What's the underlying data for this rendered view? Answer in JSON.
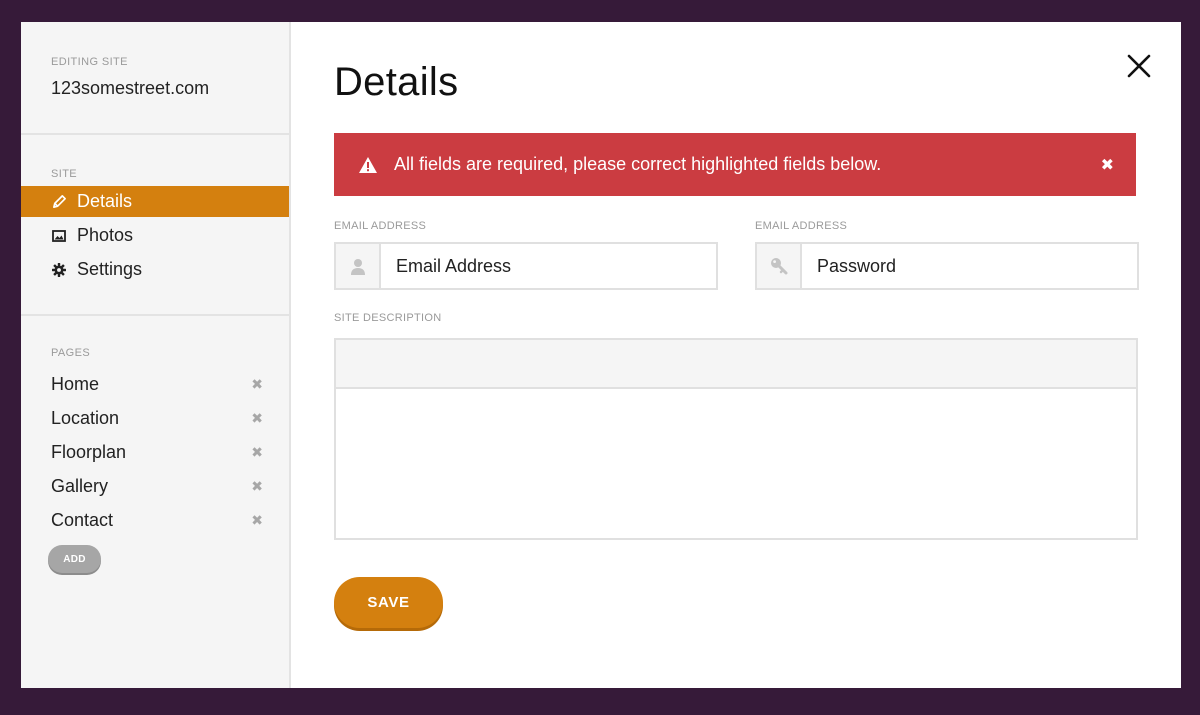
{
  "sidebar": {
    "editing_label": "EDITING SITE",
    "site_name": "123somestreet.com",
    "site_section_label": "SITE",
    "site_items": [
      {
        "label": "Details",
        "icon": "pencil-icon",
        "active": true
      },
      {
        "label": "Photos",
        "icon": "image-icon",
        "active": false
      },
      {
        "label": "Settings",
        "icon": "gear-icon",
        "active": false
      }
    ],
    "pages_section_label": "PAGES",
    "pages": [
      {
        "label": "Home"
      },
      {
        "label": "Location"
      },
      {
        "label": "Floorplan"
      },
      {
        "label": "Gallery"
      },
      {
        "label": "Contact"
      }
    ],
    "add_label": "ADD"
  },
  "main": {
    "title": "Details",
    "alert": {
      "text": "All fields are required, please correct highlighted fields below.",
      "close_glyph": "✖"
    },
    "email_field": {
      "label": "EMAIL ADDRESS",
      "placeholder": "Email Address"
    },
    "password_field": {
      "label": "EMAIL ADDRESS",
      "placeholder": "Password"
    },
    "description_label": "SITE DESCRIPTION",
    "save_label": "SAVE"
  },
  "colors": {
    "backdrop": "#361a39",
    "accent": "#d4800f",
    "alert": "#cb3c41"
  }
}
